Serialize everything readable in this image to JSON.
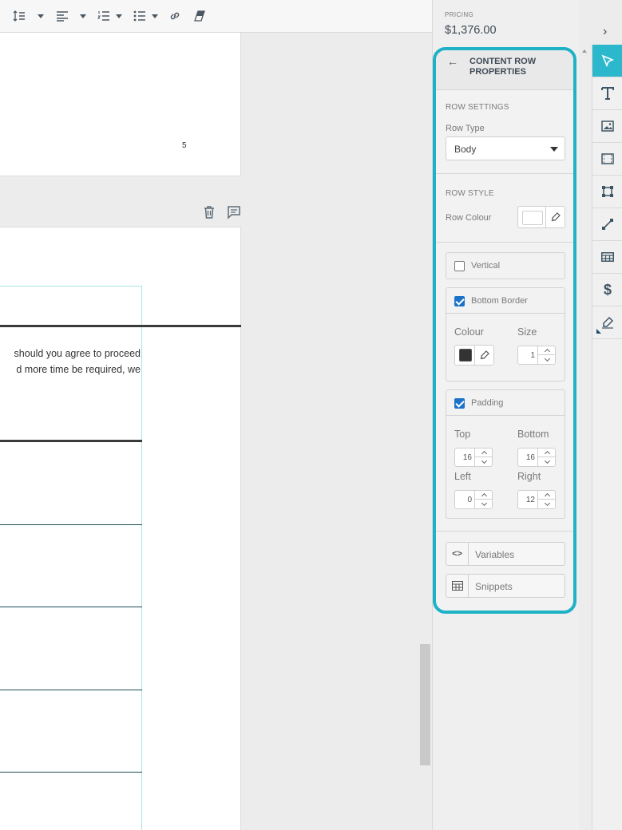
{
  "toolbar": {
    "items": [
      "line-spacing-icon",
      "align-left-icon",
      "numbered-list-icon",
      "bullet-list-icon",
      "link-icon",
      "clear-format-icon"
    ]
  },
  "document": {
    "page_number": "5",
    "body_lines": [
      "should you agree to proceed",
      "d more time be required, we"
    ]
  },
  "pricing": {
    "label": "PRICING",
    "value": "$1,376.00"
  },
  "panel": {
    "title": "CONTENT ROW PROPERTIES",
    "row_settings": {
      "heading": "ROW SETTINGS",
      "row_type_label": "Row Type",
      "row_type_value": "Body"
    },
    "row_style": {
      "heading": "ROW STYLE",
      "row_colour_label": "Row Colour",
      "row_colour": "#ffffff"
    },
    "vertical": {
      "label": "Vertical",
      "checked": false
    },
    "bottom_border": {
      "label": "Bottom Border",
      "checked": true,
      "colour_label": "Colour",
      "size_label": "Size",
      "colour": "#333333",
      "size": "1"
    },
    "padding": {
      "label": "Padding",
      "checked": true,
      "top_label": "Top",
      "bottom_label": "Bottom",
      "left_label": "Left",
      "right_label": "Right",
      "top": "16",
      "bottom": "16",
      "left": "0",
      "right": "12"
    },
    "variables_label": "Variables",
    "variables_icon": "<>",
    "snippets_label": "Snippets"
  },
  "rail": {
    "items": [
      "select-icon",
      "text-icon",
      "image-icon",
      "video-icon",
      "block-icon",
      "line-icon",
      "table-icon",
      "pricing-icon",
      "signature-icon"
    ]
  },
  "colors": {
    "accent": "#1fb1c6",
    "rail_active": "#2bb7cc",
    "checkbox": "#1a73c9"
  }
}
